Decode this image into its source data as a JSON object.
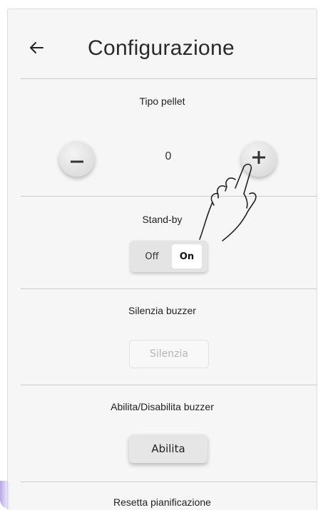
{
  "header": {
    "back_icon": "arrow-left-icon",
    "title": "Configurazione"
  },
  "pellet": {
    "title": "Tipo pellet",
    "value": "0",
    "decrement_icon": "minus-icon",
    "increment_icon": "plus-icon"
  },
  "standby": {
    "title": "Stand-by",
    "off_label": "Off",
    "on_label": "On",
    "selected": "On"
  },
  "buzzer_silence": {
    "title": "Silenzia buzzer",
    "button_label": "Silenzia",
    "button_enabled": false
  },
  "buzzer_toggle": {
    "title": "Abilita/Disabilita buzzer",
    "button_label": "Abilita"
  },
  "schedule_reset": {
    "title": "Resetta pianificazione"
  },
  "overlay": {
    "gesture_icon": "tap-hand-icon"
  },
  "colors": {
    "panel_background": "#f6f6f6",
    "divider": "#c9c9c9",
    "text": "#222222",
    "disabled_text": "#b5b5b5"
  }
}
